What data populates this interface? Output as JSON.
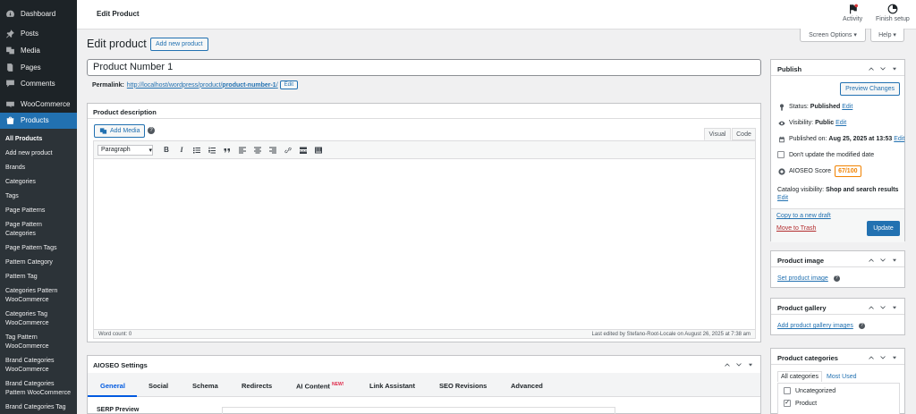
{
  "sidebar": {
    "items": [
      {
        "label": "Dashboard",
        "icon": "dashboard-icon"
      },
      {
        "label": "Posts",
        "icon": "pin-icon"
      },
      {
        "label": "Media",
        "icon": "media-icon"
      },
      {
        "label": "Pages",
        "icon": "pages-icon"
      },
      {
        "label": "Comments",
        "icon": "comments-icon"
      },
      {
        "label": "WooCommerce",
        "icon": "woocommerce-icon"
      },
      {
        "label": "Products",
        "icon": "products-icon"
      }
    ],
    "submenu": [
      "All Products",
      "Add new product",
      "Brands",
      "Categories",
      "Tags",
      "Page Patterns",
      "Page Pattern Categories",
      "Page Pattern Tags",
      "Pattern Category",
      "Pattern Tag",
      "Categories Pattern WooCommerce",
      "Categories Tag WooCommerce",
      "Tag Pattern WooCommerce",
      "Brand Categories WooCommerce",
      "Brand Categories Pattern WooCommerce",
      "Brand Categories Tag"
    ]
  },
  "header": {
    "title": "Edit Product",
    "activity": "Activity",
    "finish_setup": "Finish setup",
    "screen_options": "Screen Options ▾",
    "help": "Help ▾"
  },
  "main": {
    "heading": "Edit product",
    "add_new": "Add new product",
    "title_value": "Product Number 1",
    "permalink_label": "Permalink:",
    "permalink_base": "http://localhost/wordpress/product/",
    "permalink_slug": "product-number-1",
    "permalink_trail": "/",
    "permalink_edit": "Edit"
  },
  "description": {
    "title": "Product description",
    "add_media": "Add Media",
    "help": "?",
    "tab_visual": "Visual",
    "tab_code": "Code",
    "format": "Paragraph",
    "word_count": "Word count: 0",
    "last_edited": "Last edited by Stefano-Root-Locale on August 26, 2025 at 7:38 am"
  },
  "aioseo": {
    "title": "AIOSEO Settings",
    "tabs": [
      "General",
      "Social",
      "Schema",
      "Redirects",
      "AI Content",
      "Link Assistant",
      "SEO Revisions",
      "Advanced"
    ],
    "new_badge": "NEW!",
    "serp_label": "SERP Preview"
  },
  "publish": {
    "title": "Publish",
    "preview": "Preview Changes",
    "status_label": "Status:",
    "status_value": "Published",
    "visibility_label": "Visibility:",
    "visibility_value": "Public",
    "published_label": "Published on:",
    "published_value": "Aug 25, 2025 at 13:53",
    "edit": "Edit",
    "dont_update": "Don't update the modified date",
    "aioseo_score_label": "AIOSEO Score",
    "aioseo_score": "67/100",
    "catalog_label": "Catalog visibility:",
    "catalog_value": "Shop and search results",
    "copy_draft": "Copy to a new draft",
    "move_trash": "Move to Trash",
    "update": "Update"
  },
  "product_image": {
    "title": "Product image",
    "link": "Set product image",
    "help": "?"
  },
  "product_gallery": {
    "title": "Product gallery",
    "link": "Add product gallery images",
    "help": "?"
  },
  "product_categories": {
    "title": "Product categories",
    "tab_all": "All categories",
    "tab_most": "Most Used",
    "items": [
      {
        "label": "Uncategorized",
        "checked": false
      },
      {
        "label": "Product",
        "checked": true
      }
    ]
  },
  "colors": {
    "accent": "#2271b1",
    "sidebar_bg": "#1d2327",
    "aioseo_accent": "#005ae0",
    "score": "#f18200"
  }
}
